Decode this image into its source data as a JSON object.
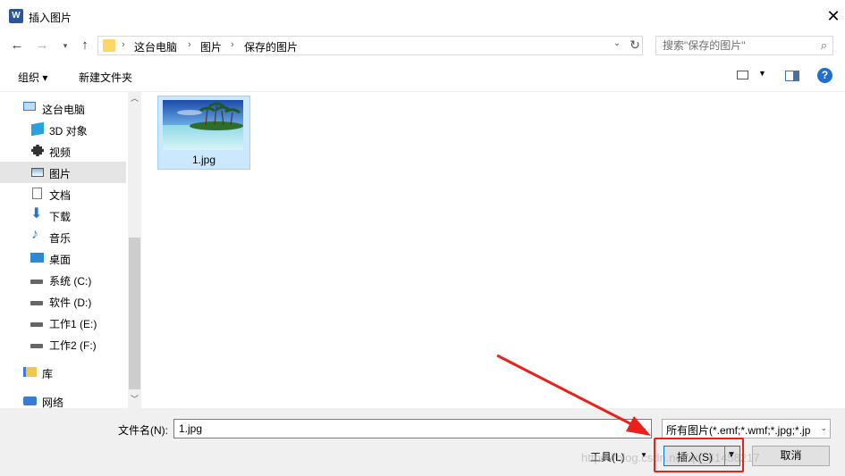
{
  "window": {
    "title": "插入图片",
    "app_icon": "W"
  },
  "nav": {
    "breadcrumb": [
      "这台电脑",
      "图片",
      "保存的图片"
    ],
    "search_placeholder": "搜索\"保存的图片\""
  },
  "toolbar": {
    "organize": "组织 ▾",
    "new_folder": "新建文件夹"
  },
  "sidebar": {
    "items": [
      {
        "label": "这台电脑",
        "icon": "computer-icon"
      },
      {
        "label": "3D 对象",
        "icon": "cube-icon"
      },
      {
        "label": "视频",
        "icon": "video-icon"
      },
      {
        "label": "图片",
        "icon": "pictures-icon",
        "selected": true
      },
      {
        "label": "文档",
        "icon": "document-icon"
      },
      {
        "label": "下载",
        "icon": "download-icon"
      },
      {
        "label": "音乐",
        "icon": "music-icon"
      },
      {
        "label": "桌面",
        "icon": "desktop-icon"
      },
      {
        "label": "系统 (C:)",
        "icon": "drive-icon"
      },
      {
        "label": "软件 (D:)",
        "icon": "drive-icon"
      },
      {
        "label": "工作1 (E:)",
        "icon": "drive-icon"
      },
      {
        "label": "工作2 (F:)",
        "icon": "drive-icon"
      },
      {
        "label": "库",
        "icon": "library-icon"
      },
      {
        "label": "网络",
        "icon": "network-icon"
      }
    ]
  },
  "files": [
    {
      "name": "1.jpg"
    }
  ],
  "bottom": {
    "filename_label": "文件名(N):",
    "filename_value": "1.jpg",
    "filter_value": "所有图片(*.emf;*.wmf;*.jpg;*.jp",
    "tools_label": "工具(L)",
    "insert_label": "插入(S)",
    "cancel_label": "取消"
  },
  "watermark": "https://blog.csdn.net/qq_41458217",
  "colors": {
    "selection": "#cce8ff",
    "accent": "#0078d7",
    "annotation": "#e8211b"
  }
}
